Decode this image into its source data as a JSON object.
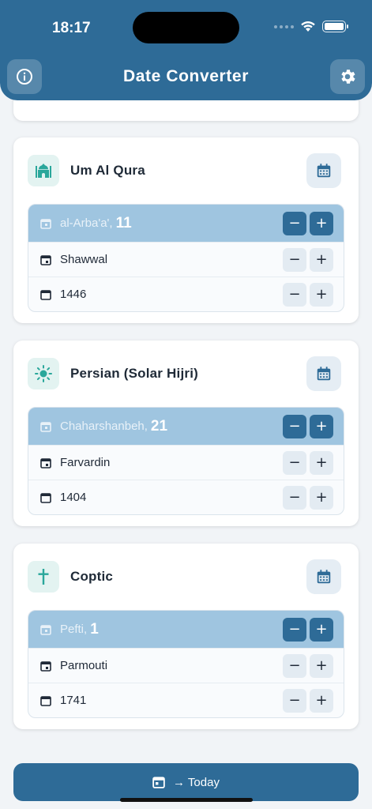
{
  "status_bar": {
    "time": "18:17"
  },
  "header": {
    "title": "Date Converter"
  },
  "calendars": [
    {
      "name": "Um Al Qura",
      "day_name": "al-Arba'a',",
      "day_number": "11",
      "month": "Shawwal",
      "year": "1446",
      "icon": "mosque-icon"
    },
    {
      "name": "Persian (Solar Hijri)",
      "day_name": "Chaharshanbeh,",
      "day_number": "21",
      "month": "Farvardin",
      "year": "1404",
      "icon": "sun-icon"
    },
    {
      "name": "Coptic",
      "day_name": "Pefti,",
      "day_number": "1",
      "month": "Parmouti",
      "year": "1741",
      "icon": "cross-icon"
    }
  ],
  "stepper": {
    "minus": "−",
    "plus": "+"
  },
  "footer": {
    "today_label": "→ Today"
  },
  "colors": {
    "primary": "#2e6b97",
    "active_row": "#9fc5e0",
    "teal_icon": "#2aa79b"
  }
}
